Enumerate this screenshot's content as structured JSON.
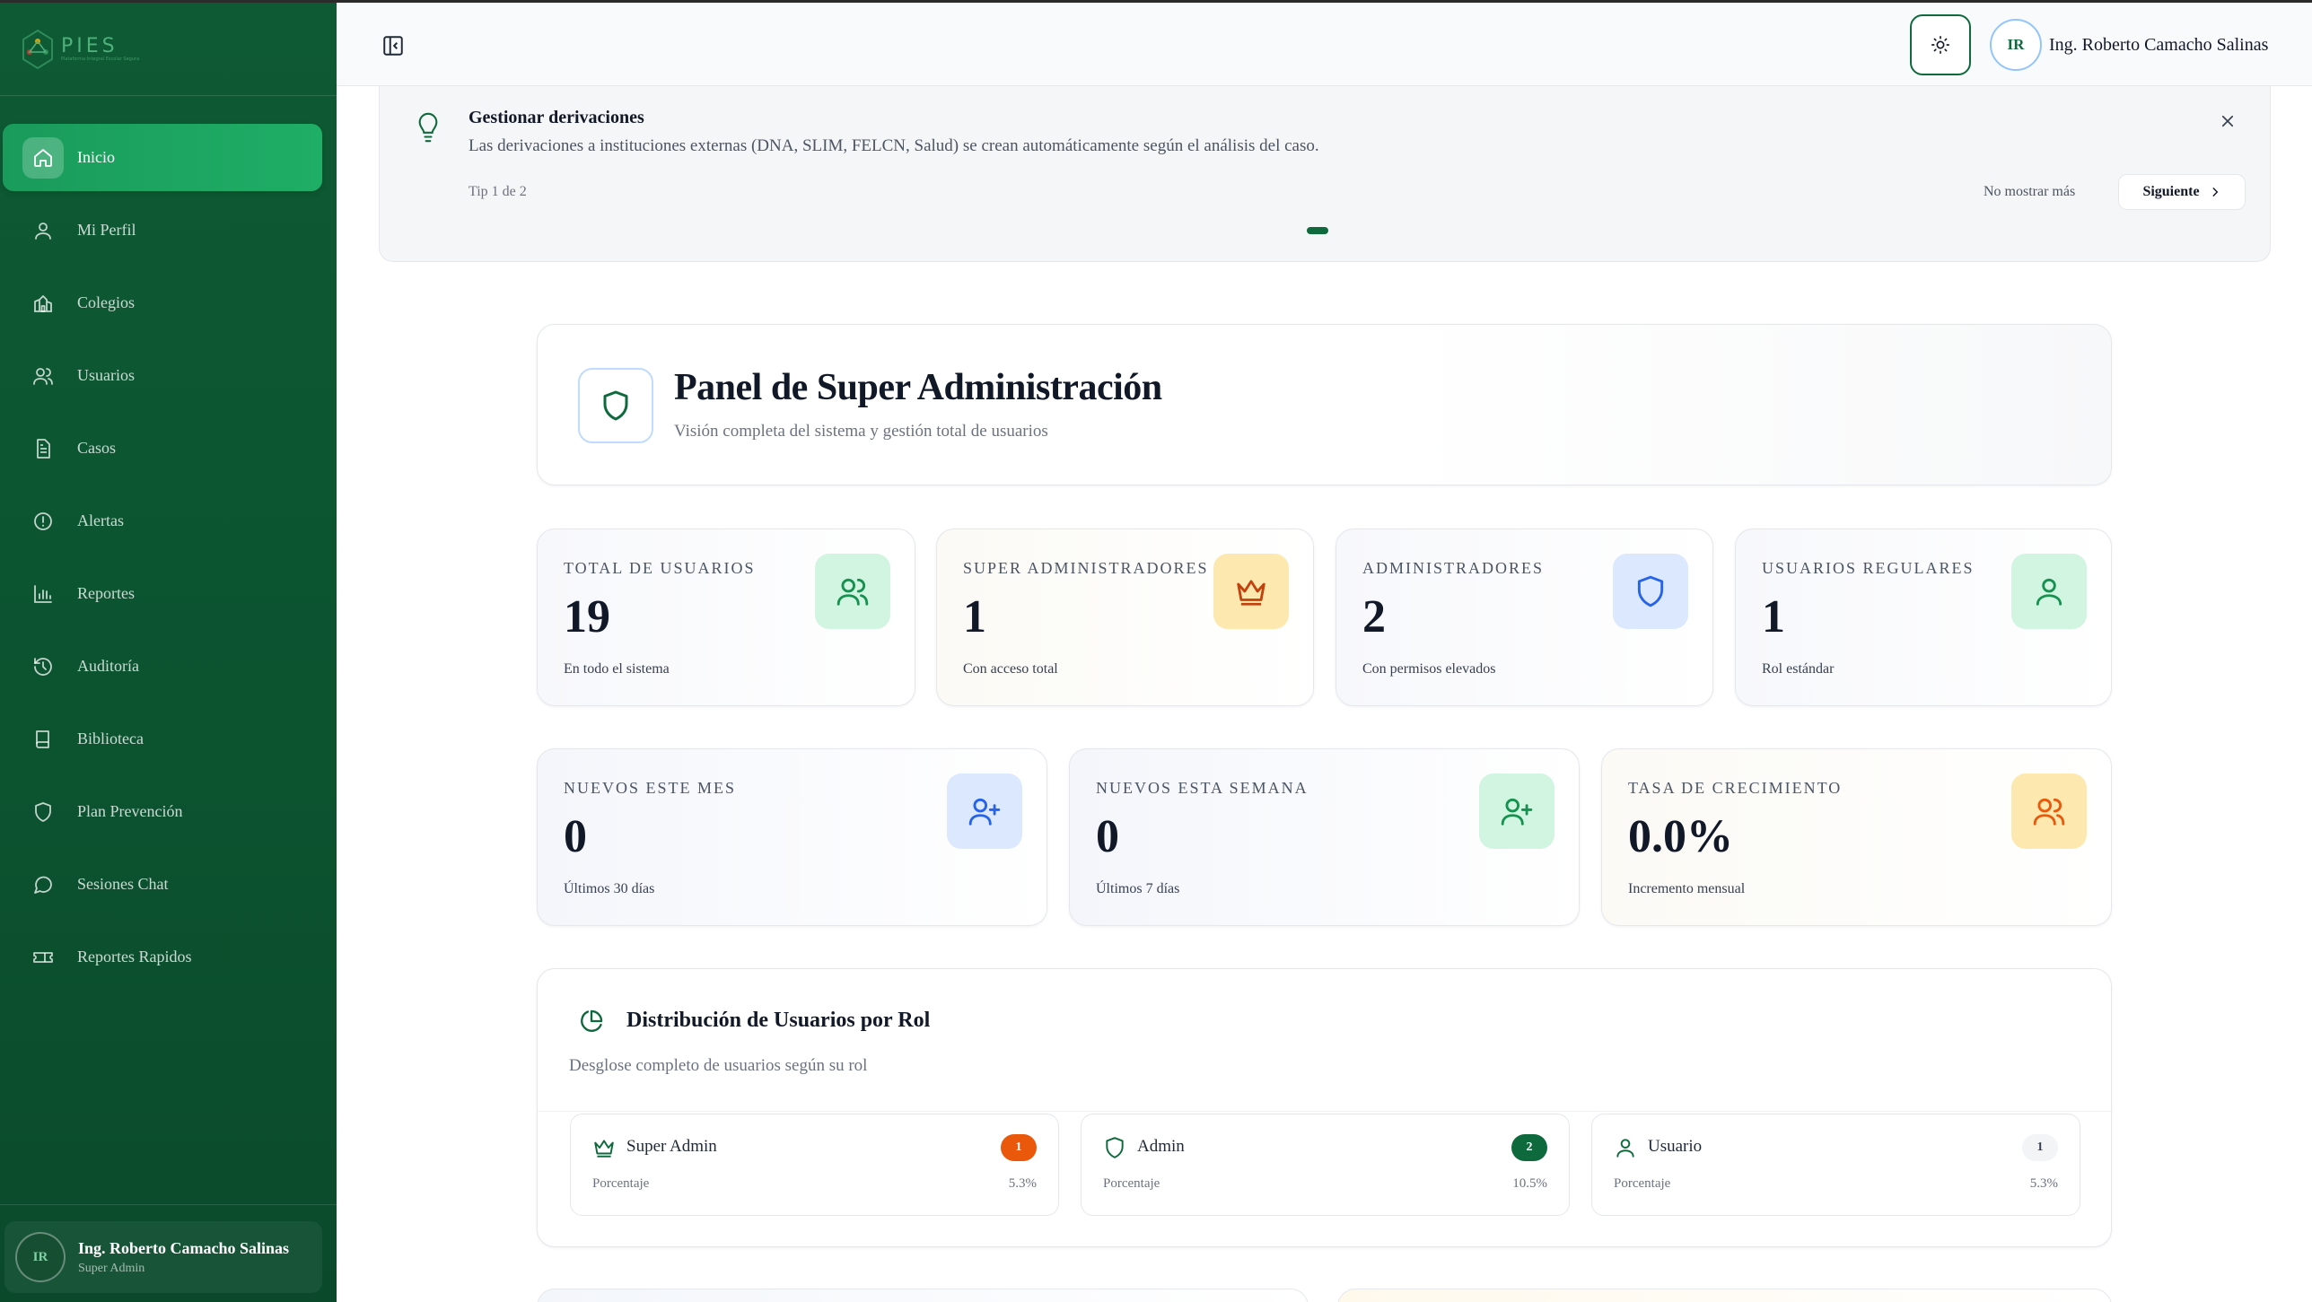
{
  "brand": {
    "logo_text": "PIES",
    "logo_subtitle": "Plataforma Integral Escolar Segura",
    "accent": "#0e6a3c"
  },
  "sidebar": {
    "items": [
      {
        "label": "Inicio",
        "icon": "home-icon",
        "active": true
      },
      {
        "label": "Mi Perfil",
        "icon": "user-icon",
        "active": false
      },
      {
        "label": "Colegios",
        "icon": "school-icon",
        "active": false
      },
      {
        "label": "Usuarios",
        "icon": "users-icon",
        "active": false
      },
      {
        "label": "Casos",
        "icon": "file-text-icon",
        "active": false
      },
      {
        "label": "Alertas",
        "icon": "alert-circle-icon",
        "active": false
      },
      {
        "label": "Reportes",
        "icon": "bar-chart-icon",
        "active": false
      },
      {
        "label": "Auditoría",
        "icon": "history-icon",
        "active": false
      },
      {
        "label": "Biblioteca",
        "icon": "book-icon",
        "active": false
      },
      {
        "label": "Plan Prevención",
        "icon": "shield-icon",
        "active": false
      },
      {
        "label": "Sesiones Chat",
        "icon": "message-circle-icon",
        "active": false
      },
      {
        "label": "Reportes Rapidos",
        "icon": "ticket-icon",
        "active": false
      }
    ],
    "user": {
      "initials": "IR",
      "name": "Ing. Roberto Camacho Salinas",
      "role": "Super Admin"
    }
  },
  "topbar": {
    "user_initials": "IR",
    "user_name": "Ing. Roberto Camacho Salinas"
  },
  "tip": {
    "title": "Gestionar derivaciones",
    "text": "Las derivaciones a instituciones externas (DNA, SLIM, FELCN, Salud) se crean automáticamente según el análisis del caso.",
    "counter": "Tip 1 de 2",
    "dismiss_label": "No mostrar más",
    "next_label": "Siguiente"
  },
  "header": {
    "title": "Panel de Super Administración",
    "subtitle": "Visión completa del sistema y gestión total de usuarios"
  },
  "stats_row1": [
    {
      "label": "TOTAL DE USUARIOS",
      "value": "19",
      "foot": "En todo el sistema",
      "icon": "users-icon",
      "tone": "green"
    },
    {
      "label": "SUPER ADMINISTRADORES",
      "value": "1",
      "foot": "Con acceso total",
      "icon": "crown-icon",
      "tone": "amber"
    },
    {
      "label": "ADMINISTRADORES",
      "value": "2",
      "foot": "Con permisos elevados",
      "icon": "shield-icon",
      "tone": "blue"
    },
    {
      "label": "USUARIOS REGULARES",
      "value": "1",
      "foot": "Rol estándar",
      "icon": "user-icon",
      "tone": "green"
    }
  ],
  "stats_row2": [
    {
      "label": "NUEVOS ESTE MES",
      "value": "0",
      "foot": "Últimos 30 días",
      "icon": "user-plus-icon",
      "tone": "blue"
    },
    {
      "label": "NUEVOS ESTA SEMANA",
      "value": "0",
      "foot": "Últimos 7 días",
      "icon": "user-plus-icon",
      "tone": "green"
    },
    {
      "label": "TASA DE CRECIMIENTO",
      "value": "0.0%",
      "foot": "Incremento mensual",
      "icon": "users-icon",
      "tone": "amber"
    }
  ],
  "distribution": {
    "title": "Distribución de Usuarios por Rol",
    "subtitle": "Desglose completo de usuarios según su rol",
    "roles": [
      {
        "name": "Super Admin",
        "count": "1",
        "pct_label": "Porcentaje",
        "pct": "5.3%",
        "icon": "crown-icon",
        "badge_color": "#ea580c"
      },
      {
        "name": "Admin",
        "count": "2",
        "pct_label": "Porcentaje",
        "pct": "10.5%",
        "icon": "shield-icon",
        "badge_color": "#0e6a3c"
      },
      {
        "name": "Usuario",
        "count": "1",
        "pct_label": "Porcentaje",
        "pct": "5.3%",
        "icon": "user-icon",
        "badge_color": "#f3f4f6"
      }
    ]
  }
}
